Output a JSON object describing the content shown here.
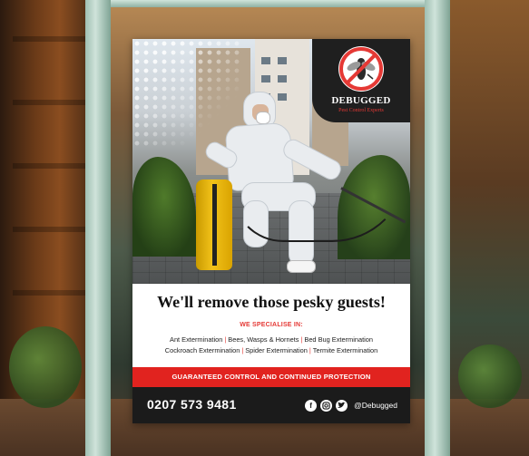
{
  "brand": {
    "name": "DEBUGGED",
    "tagline": "Pest Control Experts"
  },
  "poster": {
    "headline": "We'll remove those pesky guests!",
    "specialise_heading": "WE SPECIALISE IN:",
    "services": [
      "Ant Extermination",
      "Bees, Wasps & Hornets",
      "Bed Bug Extermination",
      "Cockroach Extermination",
      "Spider Extermination",
      "Termite Extermination"
    ],
    "guarantee": "GUARANTEED CONTROL AND CONTINUED PROTECTION",
    "phone": "0207 573 9481",
    "social_handle": "@Debugged",
    "social_icons": [
      "facebook-icon",
      "instagram-icon",
      "twitter-icon"
    ]
  },
  "colors": {
    "accent_red": "#e1231f",
    "footer_dark": "#1b1b1b",
    "tank_yellow": "#f2c21a"
  }
}
